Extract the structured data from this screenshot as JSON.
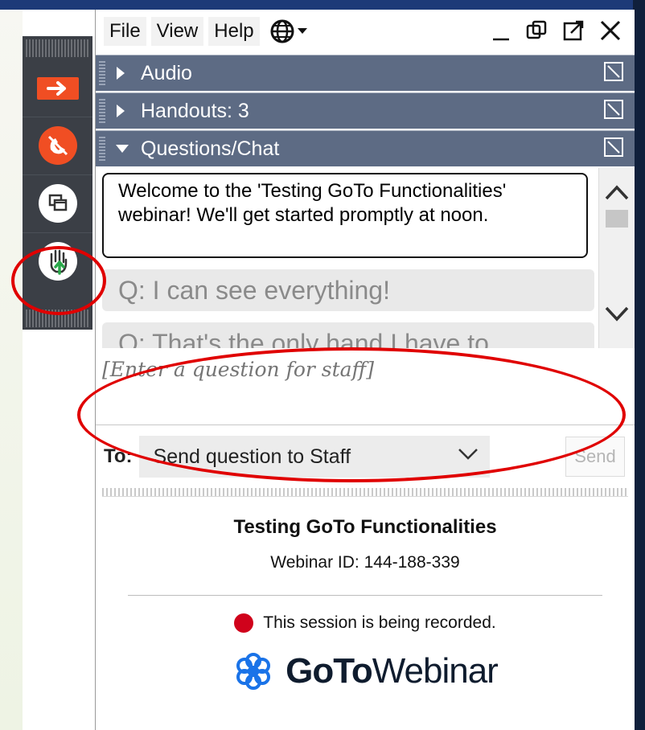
{
  "menu": {
    "file": "File",
    "view": "View",
    "help": "Help",
    "language_icon": "globe-icon"
  },
  "window_controls": [
    "minimize-icon",
    "restore-icon",
    "popout-icon",
    "close-icon"
  ],
  "sections": {
    "audio": {
      "label": "Audio",
      "state": "collapsed"
    },
    "handouts": {
      "label": "Handouts: 3",
      "state": "collapsed"
    },
    "questions": {
      "label": "Questions/Chat",
      "state": "expanded"
    }
  },
  "chat": {
    "welcome_message": "Welcome to the 'Testing GoTo Functionalities' webinar! We'll get started promptly at noon.",
    "questions": [
      "Q: I can see everything!",
      "Q: That's the only hand I have to"
    ]
  },
  "input": {
    "placeholder": "[Enter a question for staff]",
    "value": ""
  },
  "send_row": {
    "to_label": "To:",
    "recipient_selected": "Send question to Staff",
    "send_label": "Send"
  },
  "info": {
    "webinar_title": "Testing GoTo Functionalities",
    "webinar_id": "Webinar ID: 144-188-339",
    "recording_notice": "This session is being recorded.",
    "brand_bold": "GoTo",
    "brand_light": "Webinar"
  },
  "toolbar_icons": [
    "arrow-right-icon",
    "hangup-phone-icon",
    "screens-icon",
    "raise-hand-icon"
  ],
  "colors": {
    "section_bar": "#5d6b84",
    "accent_orange": "#f04e23",
    "record_red": "#d0021b",
    "annotation_red": "#e00000",
    "raise_hand_green": "#2aa84a"
  }
}
